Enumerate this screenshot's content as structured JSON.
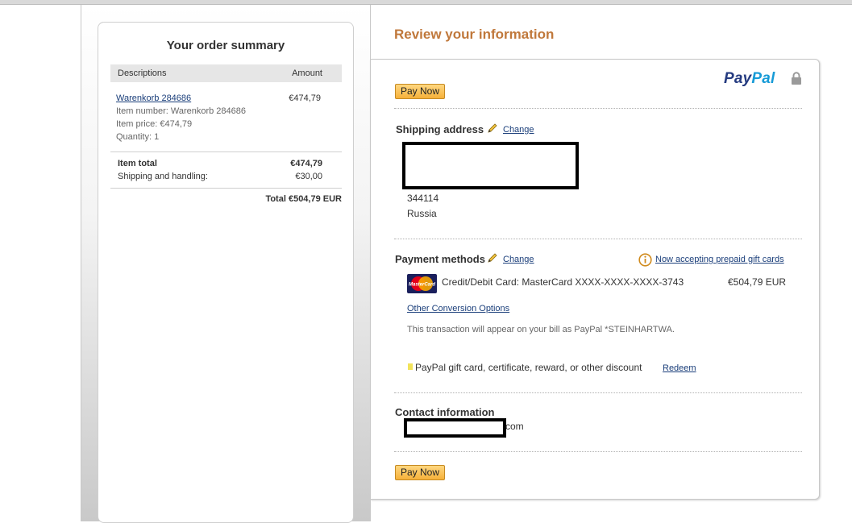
{
  "order_summary": {
    "title": "Your order summary",
    "col_description": "Descriptions",
    "col_amount": "Amount",
    "item": {
      "name": "Warenkorb 284686",
      "amount": "€474,79",
      "item_number": "Item number: Warenkorb 284686",
      "item_price": "Item price: €474,79",
      "quantity": "Quantity: 1"
    },
    "item_total_label": "Item total",
    "item_total_value": "€474,79",
    "shipping_label": "Shipping and handling:",
    "shipping_value": "€30,00",
    "total": "Total €504,79 EUR"
  },
  "review": {
    "title": "Review your information",
    "pay_now_label": "Pay Now",
    "logo_part1": "Pay",
    "logo_part2": "Pal",
    "shipping": {
      "title": "Shipping address",
      "change_label": "Change",
      "postal_code": "344114",
      "country": "Russia"
    },
    "payment": {
      "title": "Payment methods",
      "change_label": "Change",
      "prepaid_link": "Now accepting prepaid gift cards",
      "card_icon_text": "MasterCard",
      "card_text": "Credit/Debit Card: MasterCard XXXX-XXXX-XXXX-3743",
      "amount": "€504,79 EUR",
      "conversion_link": "Other Conversion Options",
      "statement_note": "This transaction will appear on your bill as PayPal *STEINHARTWA.",
      "gift_text": "PayPal gift card, certificate, reward, or other discount",
      "redeem_label": "Redeem"
    },
    "contact": {
      "title": "Contact information",
      "email_tail": "com"
    }
  },
  "colors": {
    "accent_orange": "#c0783b",
    "link_blue": "#1a3e7a",
    "paypal_dark": "#253b80",
    "paypal_light": "#179bd7",
    "button_gold": "#f6b13a"
  }
}
